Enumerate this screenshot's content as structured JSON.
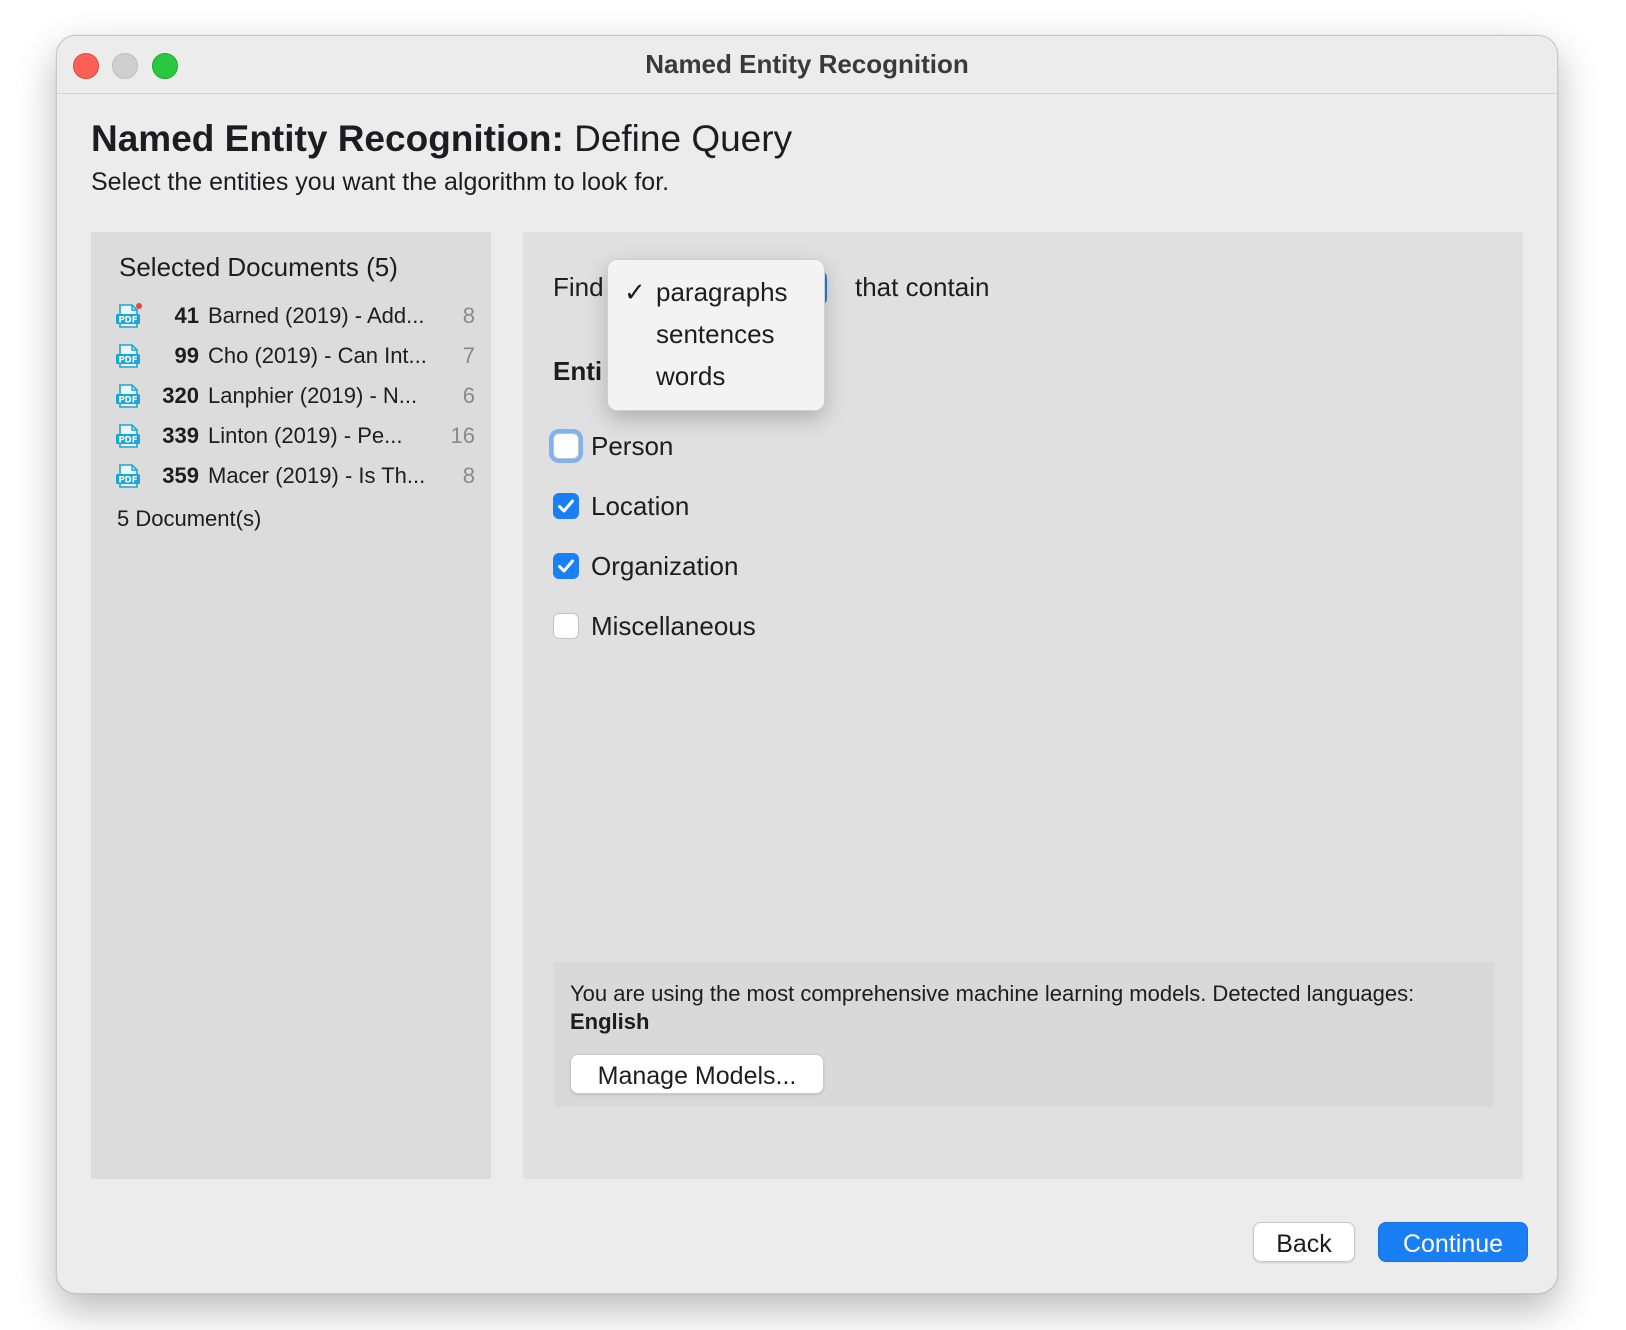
{
  "window": {
    "title": "Named Entity Recognition"
  },
  "header": {
    "title_bold": "Named Entity Recognition:",
    "title_rest": " Define Query",
    "subtitle": "Select the entities you want the algorithm to look for."
  },
  "documents": {
    "title": "Selected Documents (5)",
    "items": [
      {
        "num": "41",
        "title": "Barned (2019) - Add...",
        "count": "8",
        "icon": "pdf-icon",
        "badge": true
      },
      {
        "num": "99",
        "title": "Cho (2019) - Can Int...",
        "count": "7",
        "icon": "pdf-icon",
        "badge": false
      },
      {
        "num": "320",
        "title": "Lanphier (2019) - N...",
        "count": "6",
        "icon": "pdf-icon",
        "badge": false
      },
      {
        "num": "339",
        "title": "Linton (2019) - Pe...",
        "count": "16",
        "icon": "pdf-icon",
        "badge": false
      },
      {
        "num": "359",
        "title": "Macer (2019) - Is Th...",
        "count": "8",
        "icon": "pdf-icon",
        "badge": false
      }
    ],
    "footer": "5 Document(s)"
  },
  "query": {
    "find_label": "Find",
    "that_contain": "that contain",
    "entities_label": "Enti",
    "dropdown": {
      "options": [
        "paragraphs",
        "sentences",
        "words"
      ],
      "selected": "paragraphs",
      "check_glyph": "✓"
    },
    "entities": [
      {
        "label": "Person",
        "checked": false,
        "focused": true
      },
      {
        "label": "Location",
        "checked": true,
        "focused": false
      },
      {
        "label": "Organization",
        "checked": true,
        "focused": false
      },
      {
        "label": "Miscellaneous",
        "checked": false,
        "focused": false
      }
    ]
  },
  "models": {
    "text": "You are using the most comprehensive machine learning models. Detected languages: ",
    "language": "English",
    "manage_label": "Manage Models..."
  },
  "footer_buttons": {
    "back": "Back",
    "continue": "Continue"
  },
  "colors": {
    "accent": "#1a7ef5",
    "pdf": "#1aa6d6",
    "badge": "#e8453c"
  }
}
